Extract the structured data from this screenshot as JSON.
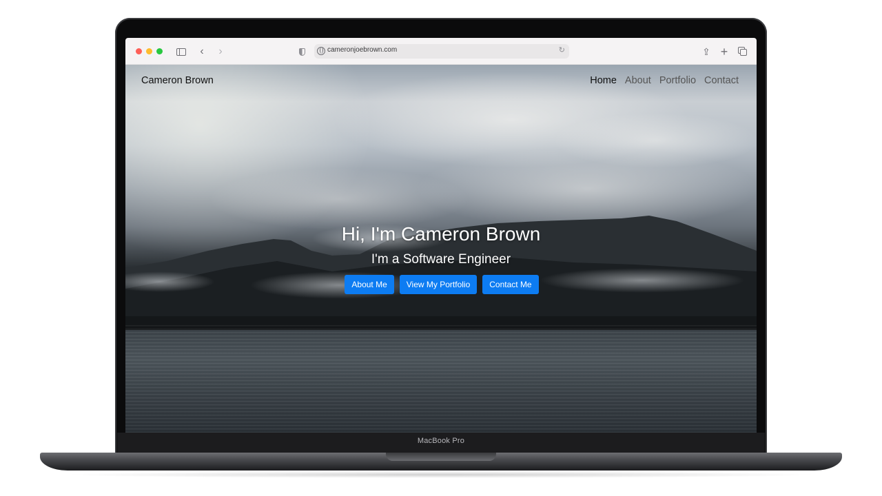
{
  "device": {
    "label": "MacBook Pro"
  },
  "browser": {
    "url": "cameronjoebrown.com",
    "icons": {
      "sidebar": "sidebar-icon",
      "back": "chevron-left-icon",
      "forward": "chevron-right-icon",
      "privacy": "shield-icon",
      "site": "globe-icon",
      "reload": "reload-icon",
      "share": "share-icon",
      "new_tab": "plus-icon",
      "tabs": "tabs-overview-icon"
    },
    "glyphs": {
      "back": "‹",
      "forward": "›",
      "reload": "↻",
      "share": "⇪",
      "new_tab": "+"
    }
  },
  "site": {
    "brand": "Cameron Brown",
    "nav": [
      {
        "label": "Home",
        "active": true
      },
      {
        "label": "About",
        "active": false
      },
      {
        "label": "Portfolio",
        "active": false
      },
      {
        "label": "Contact",
        "active": false
      }
    ],
    "hero": {
      "title": "Hi, I'm Cameron Brown",
      "subtitle": "I'm a Software Engineer",
      "buttons": [
        {
          "label": "About Me"
        },
        {
          "label": "View My Portfolio"
        },
        {
          "label": "Contact Me"
        }
      ]
    }
  },
  "colors": {
    "button": "#0d7cf2",
    "traffic_red": "#fe5f57",
    "traffic_yellow": "#febc2e",
    "traffic_green": "#28c840"
  }
}
